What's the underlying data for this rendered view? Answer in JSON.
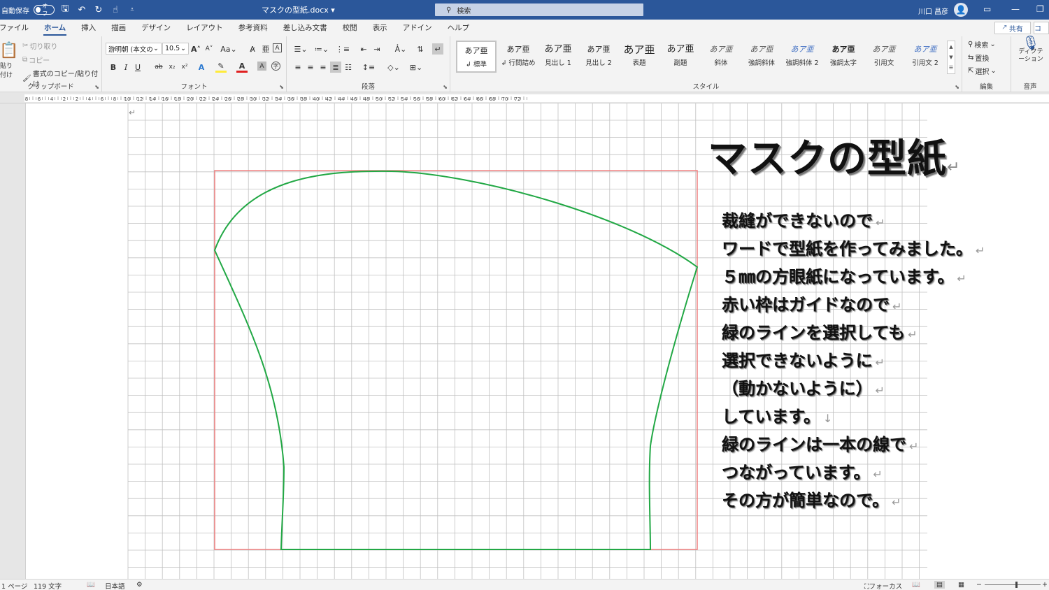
{
  "titlebar": {
    "autosave_label": "自動保存",
    "autosave_state": "オフ",
    "doc_title": "マスクの型紙.docx",
    "doc_title_caret": "▾",
    "search_placeholder": "検索",
    "user_name": "川口 昌彦"
  },
  "tabs": [
    "ファイル",
    "ホーム",
    "挿入",
    "描画",
    "デザイン",
    "レイアウト",
    "参考資料",
    "差し込み文書",
    "校閲",
    "表示",
    "アドイン",
    "ヘルプ"
  ],
  "tabs_active": "ホーム",
  "share_label": "共有",
  "comment_label": "コ",
  "clipboard": {
    "paste_label": "貼り付け",
    "cut_label": "切り取り",
    "copy_label": "コピー",
    "format_painter_label": "書式のコピー/貼り付け",
    "group_label": "クリップボード"
  },
  "font": {
    "font_name": "游明朝 (本文の",
    "font_size": "10.5",
    "group_label": "フォント",
    "case_label": "Aa",
    "bold": "B",
    "italic": "I",
    "underline": "U",
    "strike": "ab",
    "subscript": "x₂",
    "superscript": "x²",
    "grow": "A",
    "shrink": "A",
    "font_color": "A",
    "char_shade": "A"
  },
  "paragraph": {
    "group_label": "段落"
  },
  "styles": {
    "group_label": "スタイル",
    "items": [
      {
        "sample": "あア亜",
        "name": "↲ 標準"
      },
      {
        "sample": "あア亜",
        "name": "↲ 行間詰め"
      },
      {
        "sample": "あア亜",
        "name": "見出し 1"
      },
      {
        "sample": "あア亜",
        "name": "見出し 2"
      },
      {
        "sample": "あア亜",
        "name": "表題"
      },
      {
        "sample": "あア亜",
        "name": "副題"
      },
      {
        "sample": "あア亜",
        "name": "斜体"
      },
      {
        "sample": "あア亜",
        "name": "強調斜体"
      },
      {
        "sample": "あア亜",
        "name": "強調斜体 2"
      },
      {
        "sample": "あア亜",
        "name": "強調太字"
      },
      {
        "sample": "あア亜",
        "name": "引用文"
      },
      {
        "sample": "あア亜",
        "name": "引用文 2"
      }
    ]
  },
  "editing": {
    "find_label": "検索",
    "replace_label": "置換",
    "select_label": "選択",
    "group_label": "編集"
  },
  "voice": {
    "dictate_label": "ディクテーション",
    "group_label": "音声"
  },
  "ruler_numbers": [
    "8",
    "6",
    "4",
    "2",
    "2",
    "4",
    "6",
    "8",
    "10",
    "12",
    "14",
    "16",
    "18",
    "20",
    "22",
    "24",
    "26",
    "28",
    "30",
    "32",
    "34",
    "36",
    "38",
    "40",
    "42",
    "44",
    "46",
    "48",
    "50",
    "52",
    "54",
    "56",
    "58",
    "60",
    "62",
    "64",
    "66",
    "68",
    "70",
    "72"
  ],
  "document": {
    "heading": "マスクの型紙",
    "paragraphs": [
      "裁縫ができないので",
      "ワードで型紙を作ってみました。",
      "５㎜の方眼紙になっています。",
      "赤い枠はガイドなので",
      "緑のラインを選択しても",
      "選択できないように",
      "（動かないように）",
      "しています。",
      "緑のラインは一本の線で",
      "つながっています。",
      "その方が簡単なので。"
    ],
    "paragraph_mark": "↵",
    "line_break_mark": "↓"
  },
  "statusbar": {
    "page": "1 ページ",
    "words": "119 文字",
    "language": "日本語",
    "focus": "フォーカス",
    "zoom_minus": "−",
    "zoom_plus": "+"
  },
  "colors": {
    "titlebar": "#2b579a",
    "grid_line": "#c0c0c0",
    "guide_frame": "#f08080",
    "mask_line": "#22a845"
  }
}
